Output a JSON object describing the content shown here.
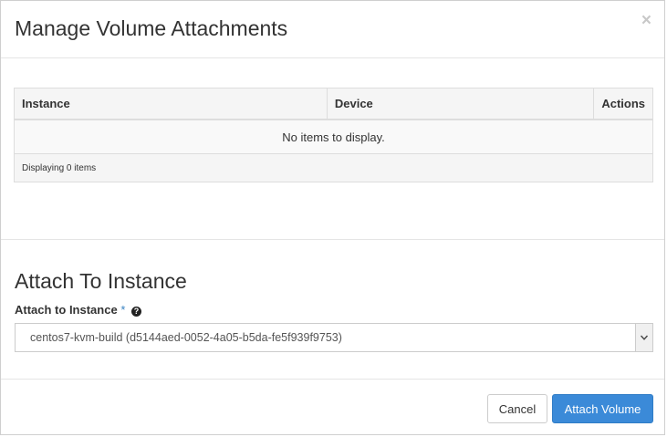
{
  "dialog": {
    "title": "Manage Volume Attachments",
    "close_symbol": "×"
  },
  "table": {
    "columns": [
      "Instance",
      "Device",
      "Actions"
    ],
    "empty_message": "No items to display.",
    "footer": "Displaying 0 items"
  },
  "attach": {
    "section_title": "Attach To Instance",
    "field_label": "Attach to Instance",
    "required_marker": "*",
    "help_icon": "question-circle-icon",
    "help_glyph": "?",
    "selected_value": "centos7-kvm-build (d5144aed-0052-4a05-b5da-fe5f939f9753)"
  },
  "buttons": {
    "cancel": "Cancel",
    "attach": "Attach Volume"
  },
  "colors": {
    "primary": "#3b8ad8",
    "required": "#3b83c2"
  }
}
